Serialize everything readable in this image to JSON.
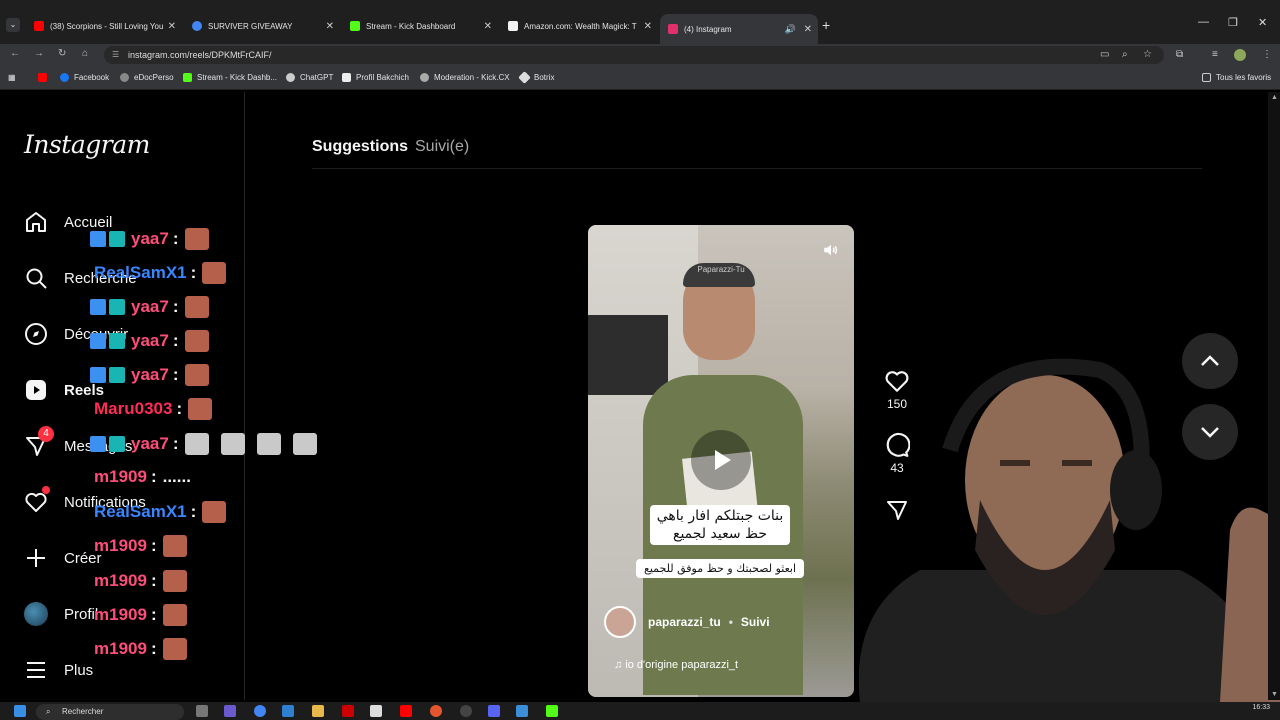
{
  "browser": {
    "tabs": [
      {
        "title": "(38) Scorpions - Still Loving You",
        "favicon_color": "#ff0000"
      },
      {
        "title": "SURVIVER GIVEAWAY",
        "favicon_color": "#4285f4"
      },
      {
        "title": "Stream - Kick Dashboard",
        "favicon_color": "#53fc18"
      },
      {
        "title": "Amazon.com: Wealth Magick: T",
        "favicon_color": "#f2f2f2"
      },
      {
        "title": "(4) Instagram",
        "favicon_color": "#e1306c"
      }
    ],
    "url": "instagram.com/reels/DPKMtFrCAIF/",
    "bookmarks": [
      "Facebook",
      "eDocPerso",
      "Stream - Kick Dashb...",
      "ChatGPT",
      "Profil Bakchich",
      "Moderation - Kick.CX",
      "Botrix"
    ],
    "all_bookmarks_label": "Tous les favoris"
  },
  "sidebar": {
    "logo": "Instagram",
    "items": [
      {
        "label": "Accueil",
        "icon": "home-icon"
      },
      {
        "label": "Recherche",
        "icon": "search-icon"
      },
      {
        "label": "Découvrir",
        "icon": "compass-icon"
      },
      {
        "label": "Reels",
        "icon": "reels-icon"
      },
      {
        "label": "Messages",
        "icon": "messenger-icon",
        "badge": "4"
      },
      {
        "label": "Notifications",
        "icon": "heart-icon"
      },
      {
        "label": "Créer",
        "icon": "plus-icon"
      },
      {
        "label": "Profil",
        "icon": "avatar-icon"
      },
      {
        "label": "Plus",
        "icon": "menu-icon"
      }
    ]
  },
  "feed_tabs": {
    "suggestions": "Suggestions",
    "following": "Suivi(e)"
  },
  "reel": {
    "watermark": "Paparazzi-Tu",
    "caption_line1": "بنات جبتلكم افار باهي",
    "caption_line2": "حظ سعيد لجميع",
    "caption_line3": "ابعثو لصحبتك و حظ موفق للجميع",
    "author": "paparazzi_tu",
    "follow": "Suivi",
    "music": "io d'origine  paparazzi_t"
  },
  "actions": {
    "likes": "150",
    "comments": "43"
  },
  "chat_overlay": [
    {
      "user": "yaa7",
      "color": "#ff4d7a",
      "badges": true,
      "msg": "",
      "emotes": 1
    },
    {
      "user": "RealSamX1",
      "color": "#3a86ff",
      "badges": false,
      "msg": "",
      "emotes": 1
    },
    {
      "user": "yaa7",
      "color": "#ff4d7a",
      "badges": true,
      "msg": "",
      "emotes": 1
    },
    {
      "user": "yaa7",
      "color": "#ff4d7a",
      "badges": true,
      "msg": "",
      "emotes": 1
    },
    {
      "user": "yaa7",
      "color": "#ff4d7a",
      "badges": true,
      "msg": "",
      "emotes": 1
    },
    {
      "user": "Maru0303",
      "color": "#ff2d55",
      "badges": false,
      "msg": "",
      "emotes": 1
    },
    {
      "user": "yaa7",
      "color": "#ff4d7a",
      "badges": true,
      "msg": "",
      "emotes": 4
    },
    {
      "user": "m1909",
      "color": "#ff4d7a",
      "badges": false,
      "msg": "......",
      "emotes": 0
    },
    {
      "user": "RealSamX1",
      "color": "#3a86ff",
      "badges": false,
      "msg": "",
      "emotes": 1
    },
    {
      "user": "m1909",
      "color": "#ff4d7a",
      "badges": false,
      "msg": "",
      "emotes": 1
    },
    {
      "user": "m1909",
      "color": "#ff4d7a",
      "badges": false,
      "msg": "",
      "emotes": 1
    },
    {
      "user": "m1909",
      "color": "#ff4d7a",
      "badges": false,
      "msg": "",
      "emotes": 1
    },
    {
      "user": "m1909",
      "color": "#ff4d7a",
      "badges": false,
      "msg": "",
      "emotes": 1
    }
  ],
  "taskbar": {
    "search_placeholder": "Rechercher",
    "time": "16:33"
  }
}
